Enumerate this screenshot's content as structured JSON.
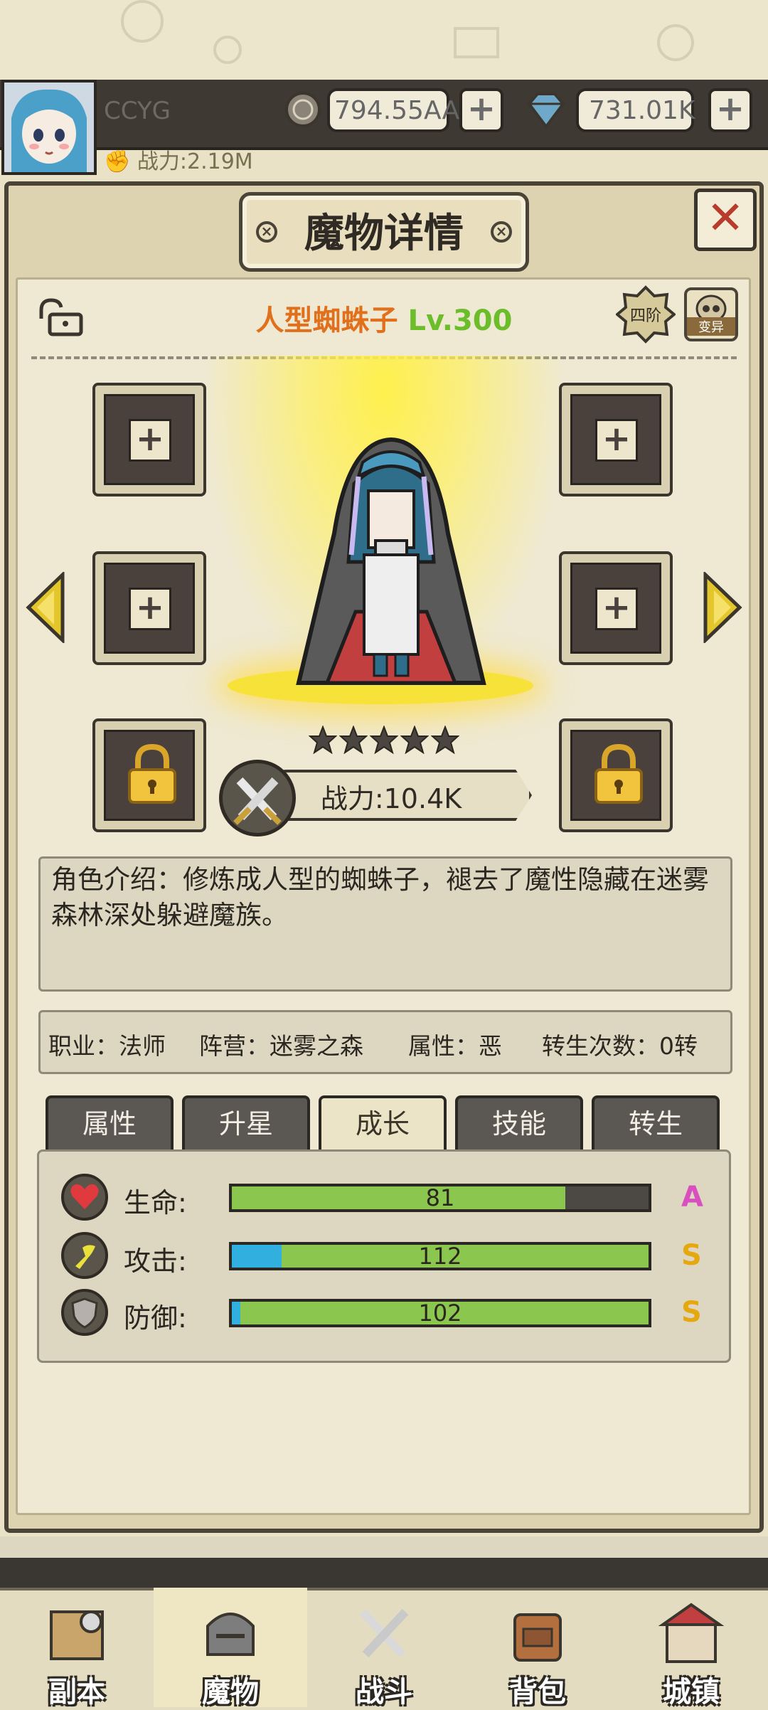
{
  "header": {
    "player_name": "CCYG",
    "power": "战力:2.19M",
    "gold": "794.55AA",
    "gems": "731.01K",
    "plus": "+"
  },
  "panel": {
    "title": "魔物详情",
    "close": "✕",
    "monster_name": "人型蜘蛛子",
    "level": "Lv.300",
    "tier": "四阶",
    "mutate": "变异",
    "stars": 5,
    "combat_power": "战力:10.4K",
    "description": "角色介绍：修炼成人型的蜘蛛子，褪去了魔性隐藏在迷雾森林深处躲避魔族。",
    "info": {
      "job": "职业：法师",
      "camp": "阵营：迷雾之森",
      "attr": "属性：恶",
      "rebirth": "转生次数：0转"
    },
    "slot_plus": "+"
  },
  "tabs": [
    {
      "label": "属性"
    },
    {
      "label": "升星"
    },
    {
      "label": "成长"
    },
    {
      "label": "技能"
    },
    {
      "label": "转生"
    }
  ],
  "active_tab": 2,
  "stats": [
    {
      "label": "生命:",
      "value": "81",
      "grade": "A",
      "green_fill": 0.8,
      "blue_fill": 0,
      "grade_color": "#d94fc0"
    },
    {
      "label": "攻击:",
      "value": "112",
      "grade": "S",
      "green_fill": 1.0,
      "blue_fill": 0.12,
      "grade_color": "#e6a80f"
    },
    {
      "label": "防御:",
      "value": "102",
      "grade": "S",
      "green_fill": 1.0,
      "blue_fill": 0.02,
      "grade_color": "#e6a80f"
    }
  ],
  "nav": [
    {
      "label": "副本",
      "icon": "map-icon"
    },
    {
      "label": "魔物",
      "icon": "monster-helmet-icon"
    },
    {
      "label": "战斗",
      "icon": "crossed-swords-icon"
    },
    {
      "label": "背包",
      "icon": "backpack-icon"
    },
    {
      "label": "城镇",
      "icon": "town-icon"
    }
  ],
  "colors": {
    "accent_orange": "#e0701c",
    "level_green": "#6bbe2a",
    "bar_green": "#8bc64f",
    "bar_blue": "#31b0e0",
    "close_red": "#b83b2c"
  }
}
